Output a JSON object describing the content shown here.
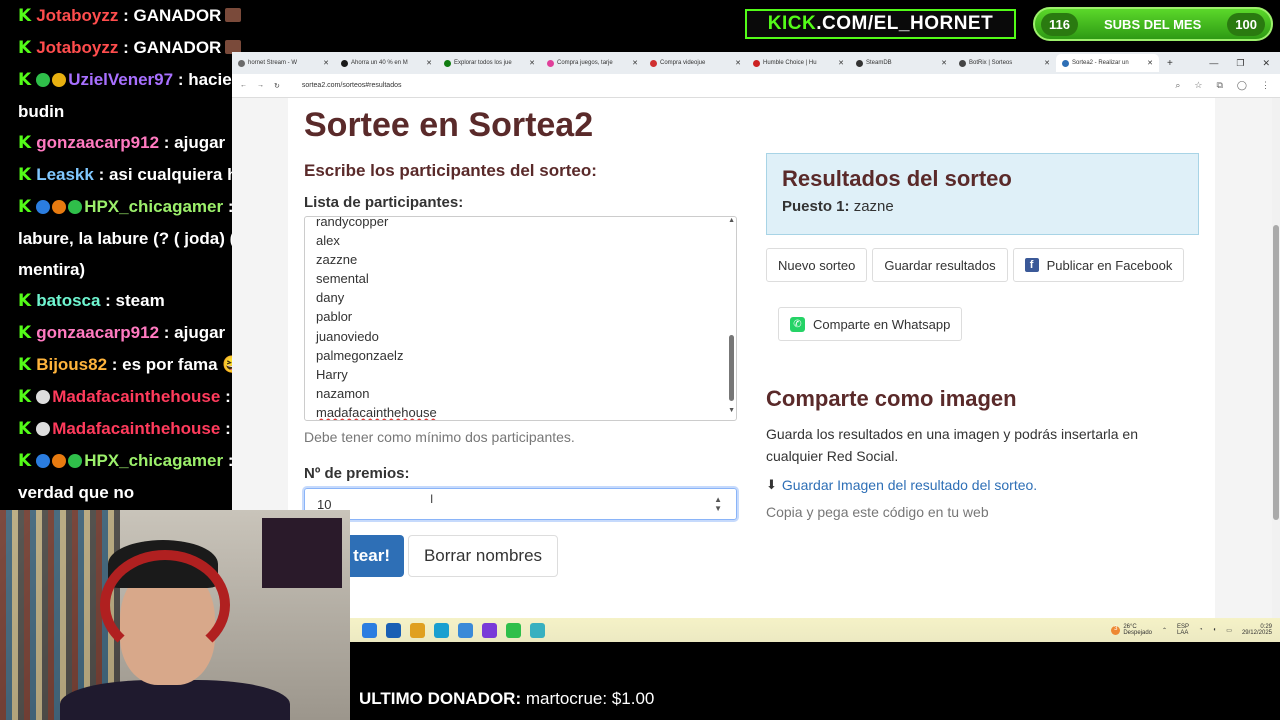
{
  "chat": [
    {
      "user": "Jotaboyzz",
      "msg": ": GANADOR",
      "user_class": "u-red",
      "badges": [],
      "emote": true
    },
    {
      "user": "Jotaboyzz",
      "msg": ": GANADOR",
      "user_class": "u-red",
      "badges": [],
      "emote": true
    },
    {
      "user": "UzielVener97",
      "msg": ": haciendo budin",
      "user_class": "u-purple",
      "badges": [
        "#2fbf4a",
        "#e8b010"
      ],
      "emote": false
    },
    {
      "user": "gonzaacarp912",
      "msg": ": ajugar",
      "user_class": "u-pink",
      "badges": [],
      "emote": false
    },
    {
      "user": "Leaskk",
      "msg": ": asi cualquiera h",
      "user_class": "u-cyan",
      "badges": [],
      "emote": true
    },
    {
      "user": "HPX_chicagamer",
      "msg": ": la labure, la labure (? ( joda) ( mentira)",
      "user_class": "u-lgreen",
      "badges": [
        "#2b7de0",
        "#e87b10",
        "#2fbf4a"
      ],
      "emote": false
    },
    {
      "user": "batosca",
      "msg": ": steam",
      "user_class": "u-teal",
      "badges": [],
      "emote": false
    },
    {
      "user": "gonzaacarp912",
      "msg": ": ajugar",
      "user_class": "u-pink",
      "badges": [],
      "emote": false
    },
    {
      "user": "Bijous82",
      "msg": ": es por fama 😆",
      "user_class": "u-orange",
      "badges": [],
      "emote": false
    },
    {
      "user": "Madafacainthehouse",
      "msg": ":",
      "user_class": "u-crimson",
      "badges": [
        "#ddd"
      ],
      "emote": true
    },
    {
      "user": "Madafacainthehouse",
      "msg": ":",
      "user_class": "u-crimson",
      "badges": [
        "#ddd"
      ],
      "emote": true
    },
    {
      "user": "HPX_chicagamer",
      "msg": ": la verdad que no",
      "user_class": "u-lgreen",
      "badges": [
        "#2b7de0",
        "#e87b10",
        "#2fbf4a"
      ],
      "emote": false
    },
    {
      "user": "Madafacainthehouse",
      "msg": ":",
      "user_class": "u-crimson",
      "badges": [
        "#ddd"
      ],
      "emote": true
    }
  ],
  "overlay": {
    "kick_prefix": "KICK",
    "kick_rest": ".COM/EL_HORNET",
    "subs_left": "116",
    "subs_label": "SUBS DEL MES",
    "subs_right": "100",
    "donor_label": "ULTIMO DONADOR:",
    "donor_value": "martocrue: $1.00"
  },
  "browser": {
    "tabs": [
      {
        "label": "hornet Stream - W",
        "color": "#6a6a6a"
      },
      {
        "label": "Ahorra un 40 % en M",
        "color": "#1a1a1a"
      },
      {
        "label": "Explorar todos los jue",
        "color": "#107c10"
      },
      {
        "label": "Compra juegos, tarje",
        "color": "#e0409a"
      },
      {
        "label": "Compra videojue",
        "color": "#d03030"
      },
      {
        "label": "Humble Choice | Hu",
        "color": "#cc2222"
      },
      {
        "label": "SteamDB",
        "color": "#333"
      },
      {
        "label": "BotRix | Sorteos",
        "color": "#444"
      },
      {
        "label": "Sortea2 - Realizar un",
        "color": "#2e6fb6"
      }
    ],
    "url": "sortea2.com/sorteos#resultados"
  },
  "page": {
    "title": "Sortee en Sortea2",
    "write_label": "Escribe los participantes del sorteo:",
    "list_label": "Lista de participantes:",
    "participants": [
      "randycopper",
      "alex",
      "zazzne",
      "semental",
      "dany",
      "pablor",
      "juanoviedo",
      "palmegonzaelz",
      "Harry",
      "nazamon",
      "madafacainthehouse"
    ],
    "help": "Debe tener como mínimo dos participantes.",
    "prizes_label": "Nº de premios:",
    "prizes_value": "10",
    "sortear_label": "¡Sortear!",
    "sortear_visible": "tear!",
    "borrar_label": "Borrar nombres",
    "results_title": "Resultados del sorteo",
    "results_place": "Puesto 1:",
    "results_winner": "zazne",
    "btn_nuevo": "Nuevo sorteo",
    "btn_guardar": "Guardar resultados",
    "btn_facebook": "Publicar en Facebook",
    "btn_whatsapp": "Comparte en Whatsapp",
    "share_title": "Comparte como imagen",
    "share_desc": "Guarda los resultados en una imagen y podrás insertarla en cualquier Red Social.",
    "save_link": "Guardar Imagen del resultado del sorteo.",
    "copy_text": "Copia y pega este código en tu web"
  },
  "taskbar": {
    "icons": [
      "#2b7de0",
      "#1a5fb4",
      "#e0a020",
      "#1a9fd0",
      "#3a8ad8",
      "#7a3ad8",
      "#2fbf4a",
      "#38b0c0"
    ],
    "weather_temp": "26°C",
    "weather_desc": "Despejado",
    "lang": "ESP",
    "lang2": "LAA",
    "time": "0:29",
    "date": "29/12/2025"
  }
}
